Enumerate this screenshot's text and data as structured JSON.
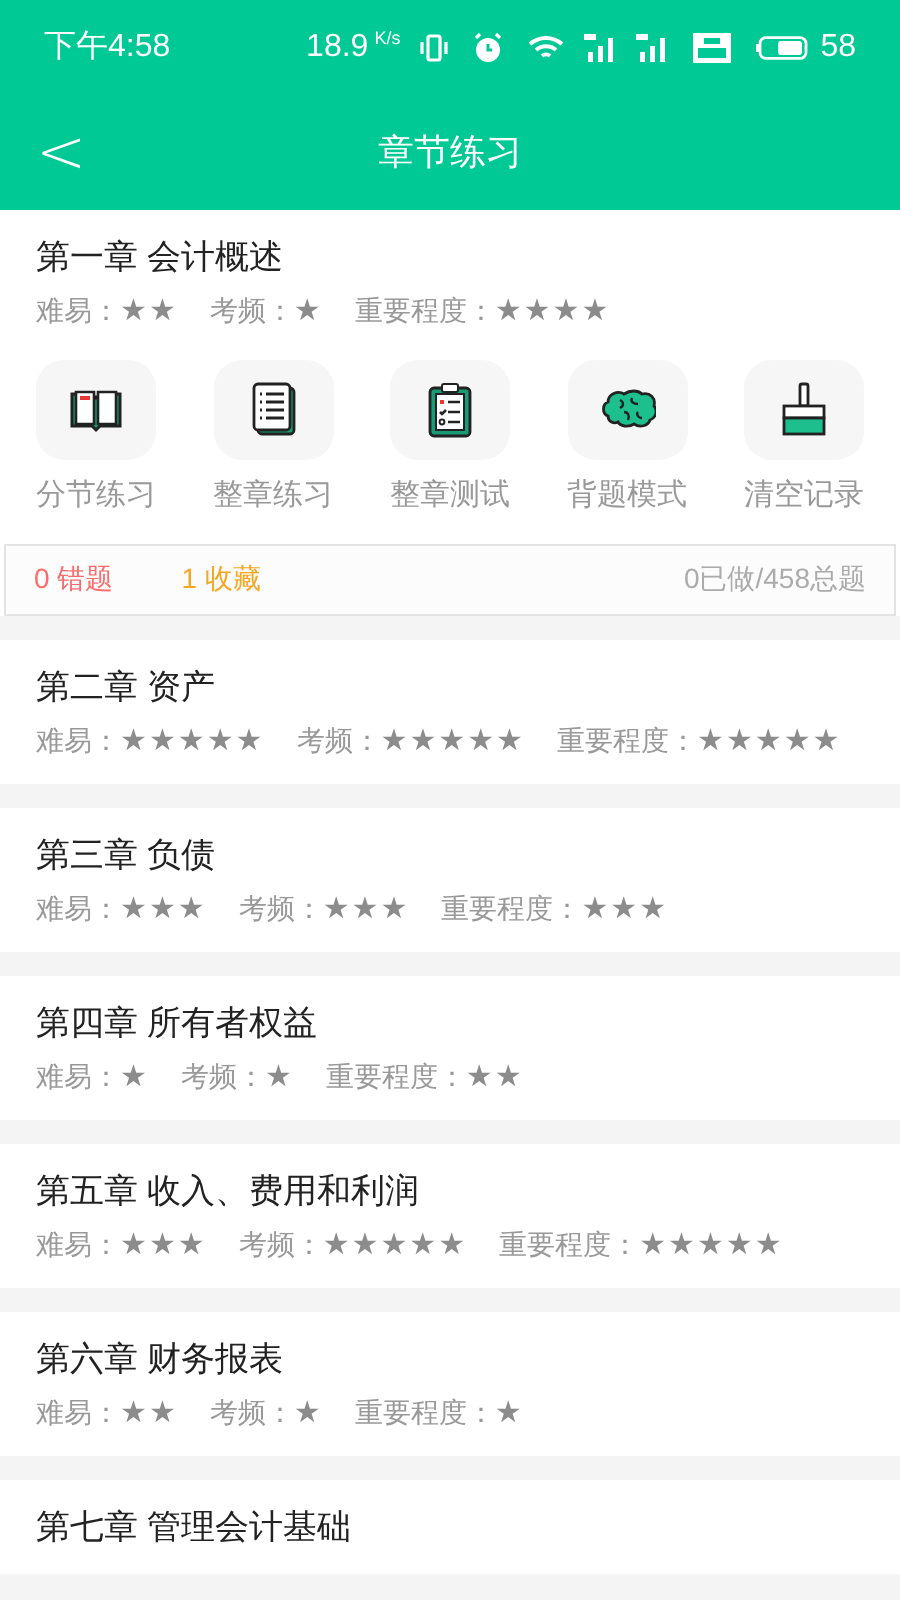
{
  "status_bar": {
    "time": "下午4:58",
    "speed": "18.9",
    "speed_unit": "K/s",
    "battery": "58"
  },
  "header": {
    "back": "<",
    "title": "章节练习"
  },
  "chapters": [
    {
      "title": "第一章 会计概述",
      "expanded": true,
      "ratings": [
        {
          "label": "难易：",
          "value": "★★"
        },
        {
          "label": "考频：",
          "value": "★"
        },
        {
          "label": "重要程度：",
          "value": "★★★★"
        }
      ],
      "actions": [
        {
          "kind": "book",
          "label": "分节练习"
        },
        {
          "kind": "list",
          "label": "整章练习"
        },
        {
          "kind": "clipboard",
          "label": "整章测试"
        },
        {
          "kind": "brain",
          "label": "背题模式"
        },
        {
          "kind": "brush",
          "label": "清空记录"
        }
      ],
      "stats": {
        "wrong": "0 错题",
        "favorites": "1 收藏",
        "progress": "0已做/458总题"
      }
    },
    {
      "title": "第二章 资产",
      "expanded": false,
      "ratings": [
        {
          "label": "难易：",
          "value": "★★★★★"
        },
        {
          "label": "考频：",
          "value": "★★★★★"
        },
        {
          "label": "重要程度：",
          "value": "★★★★★"
        }
      ]
    },
    {
      "title": "第三章 负债",
      "expanded": false,
      "ratings": [
        {
          "label": "难易：",
          "value": "★★★"
        },
        {
          "label": "考频：",
          "value": "★★★"
        },
        {
          "label": "重要程度：",
          "value": "★★★"
        }
      ]
    },
    {
      "title": "第四章 所有者权益",
      "expanded": false,
      "ratings": [
        {
          "label": "难易：",
          "value": "★"
        },
        {
          "label": "考频：",
          "value": "★"
        },
        {
          "label": "重要程度：",
          "value": "★★"
        }
      ]
    },
    {
      "title": "第五章 收入、费用和利润",
      "expanded": false,
      "ratings": [
        {
          "label": "难易：",
          "value": "★★★"
        },
        {
          "label": "考频：",
          "value": "★★★★★"
        },
        {
          "label": "重要程度：",
          "value": "★★★★★"
        }
      ]
    },
    {
      "title": "第六章 财务报表",
      "expanded": false,
      "ratings": [
        {
          "label": "难易：",
          "value": "★★"
        },
        {
          "label": "考频：",
          "value": "★"
        },
        {
          "label": "重要程度：",
          "value": "★"
        }
      ]
    },
    {
      "title": "第七章 管理会计基础",
      "expanded": false
    }
  ]
}
